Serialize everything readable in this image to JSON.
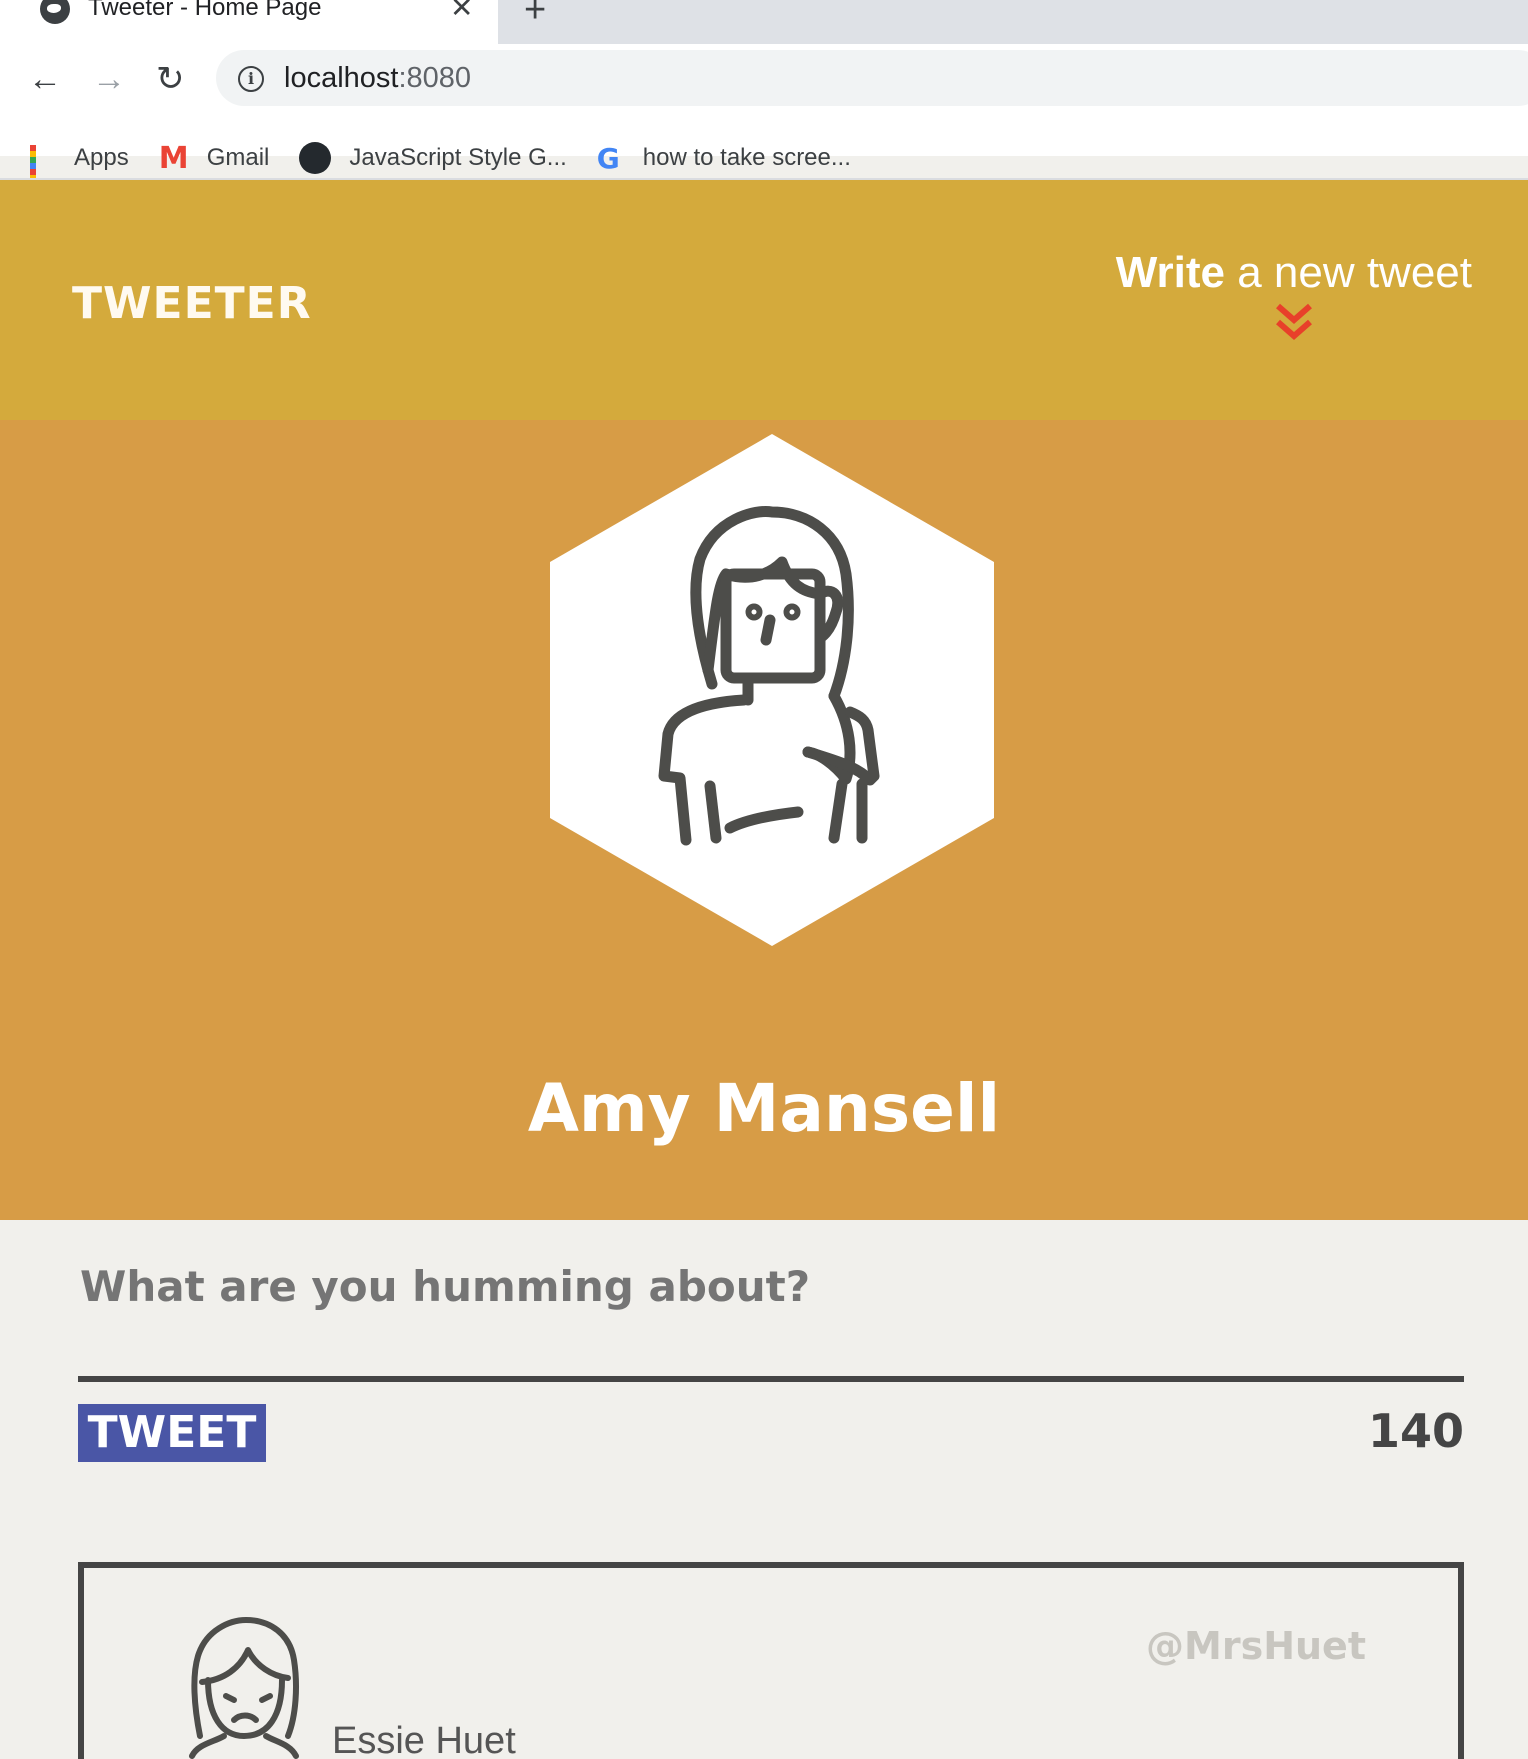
{
  "browser": {
    "tab_title": "Tweeter - Home Page",
    "url_host": "localhost",
    "url_port": ":8080",
    "bookmarks": [
      {
        "label": "Apps",
        "icon": "apps-grid-icon"
      },
      {
        "label": "Gmail",
        "icon": "gmail-icon"
      },
      {
        "label": "JavaScript Style G...",
        "icon": "github-icon"
      },
      {
        "label": "how to take scree...",
        "icon": "google-icon"
      }
    ]
  },
  "nav": {
    "brand": "TWEETER",
    "compose_bold": "Write",
    "compose_rest": " a new tweet",
    "chevron_color": "#e8402a"
  },
  "profile": {
    "name": "Amy Mansell"
  },
  "composer": {
    "placeholder": "What are you humming about?",
    "button_label": "TWEET",
    "counter": "140"
  },
  "tweets": [
    {
      "name": "Essie Huet",
      "handle": "@MrsHuet"
    }
  ],
  "colors": {
    "nav_bg": "#d4aa3c",
    "header_bg": "#d79c46",
    "page_bg": "#f1f0ec",
    "button_bg": "#4a56a6",
    "dark": "#454545"
  }
}
